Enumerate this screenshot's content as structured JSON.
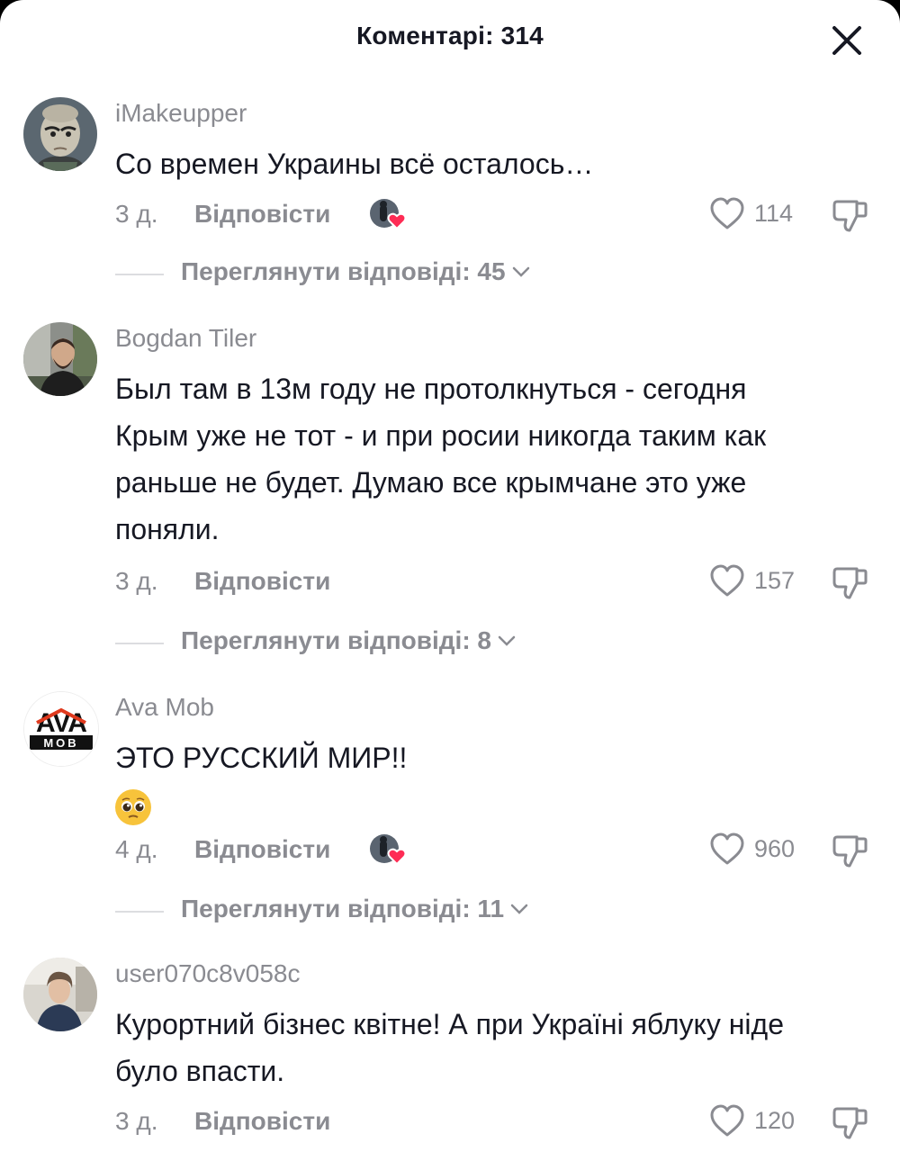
{
  "header": {
    "title": "Коментарі: 314"
  },
  "comments": [
    {
      "username": "iMakeupper",
      "lines": [
        "Со времен Украины всё осталось…"
      ],
      "time": "3 д.",
      "reply_label": "Відповісти",
      "likes": "114",
      "creator_liked": true,
      "view_replies": "Переглянути відповіді: 45"
    },
    {
      "username": "Bogdan Tiler",
      "lines": [
        "Был там в 13м году не протолкнуться - сегодня",
        "Крым уже не тот - и при росии никогда таким как",
        "раньше не будет. Думаю все крымчане это уже",
        "поняли."
      ],
      "time": "3 д.",
      "reply_label": "Відповісти",
      "likes": "157",
      "creator_liked": false,
      "view_replies": "Переглянути відповіді: 8"
    },
    {
      "username": "Ava Mob",
      "lines": [
        "ЭТО РУССКИЙ МИР!!"
      ],
      "emoji": "pleading-face",
      "time": "4 д.",
      "reply_label": "Відповісти",
      "likes": "960",
      "creator_liked": true,
      "view_replies": "Переглянути відповіді: 11"
    },
    {
      "username": "user070c8v058c",
      "lines": [
        "Курортний бізнес квітне! А при Україні яблуку ніде",
        "було впасти."
      ],
      "time": "3 д.",
      "reply_label": "Відповісти",
      "likes": "120",
      "creator_liked": false
    }
  ],
  "avatar_logo_text": {
    "top": "AVA",
    "bottom": "MOB"
  },
  "colors": {
    "text_primary": "#161823",
    "text_secondary": "#8a8b91",
    "heart_badge": "#fe2c55",
    "divider": "#dcdde0"
  },
  "icons": {
    "close": "close-icon",
    "like": "heart-outline-icon",
    "dislike": "thumbs-down-icon",
    "chevron": "chevron-down-icon"
  }
}
